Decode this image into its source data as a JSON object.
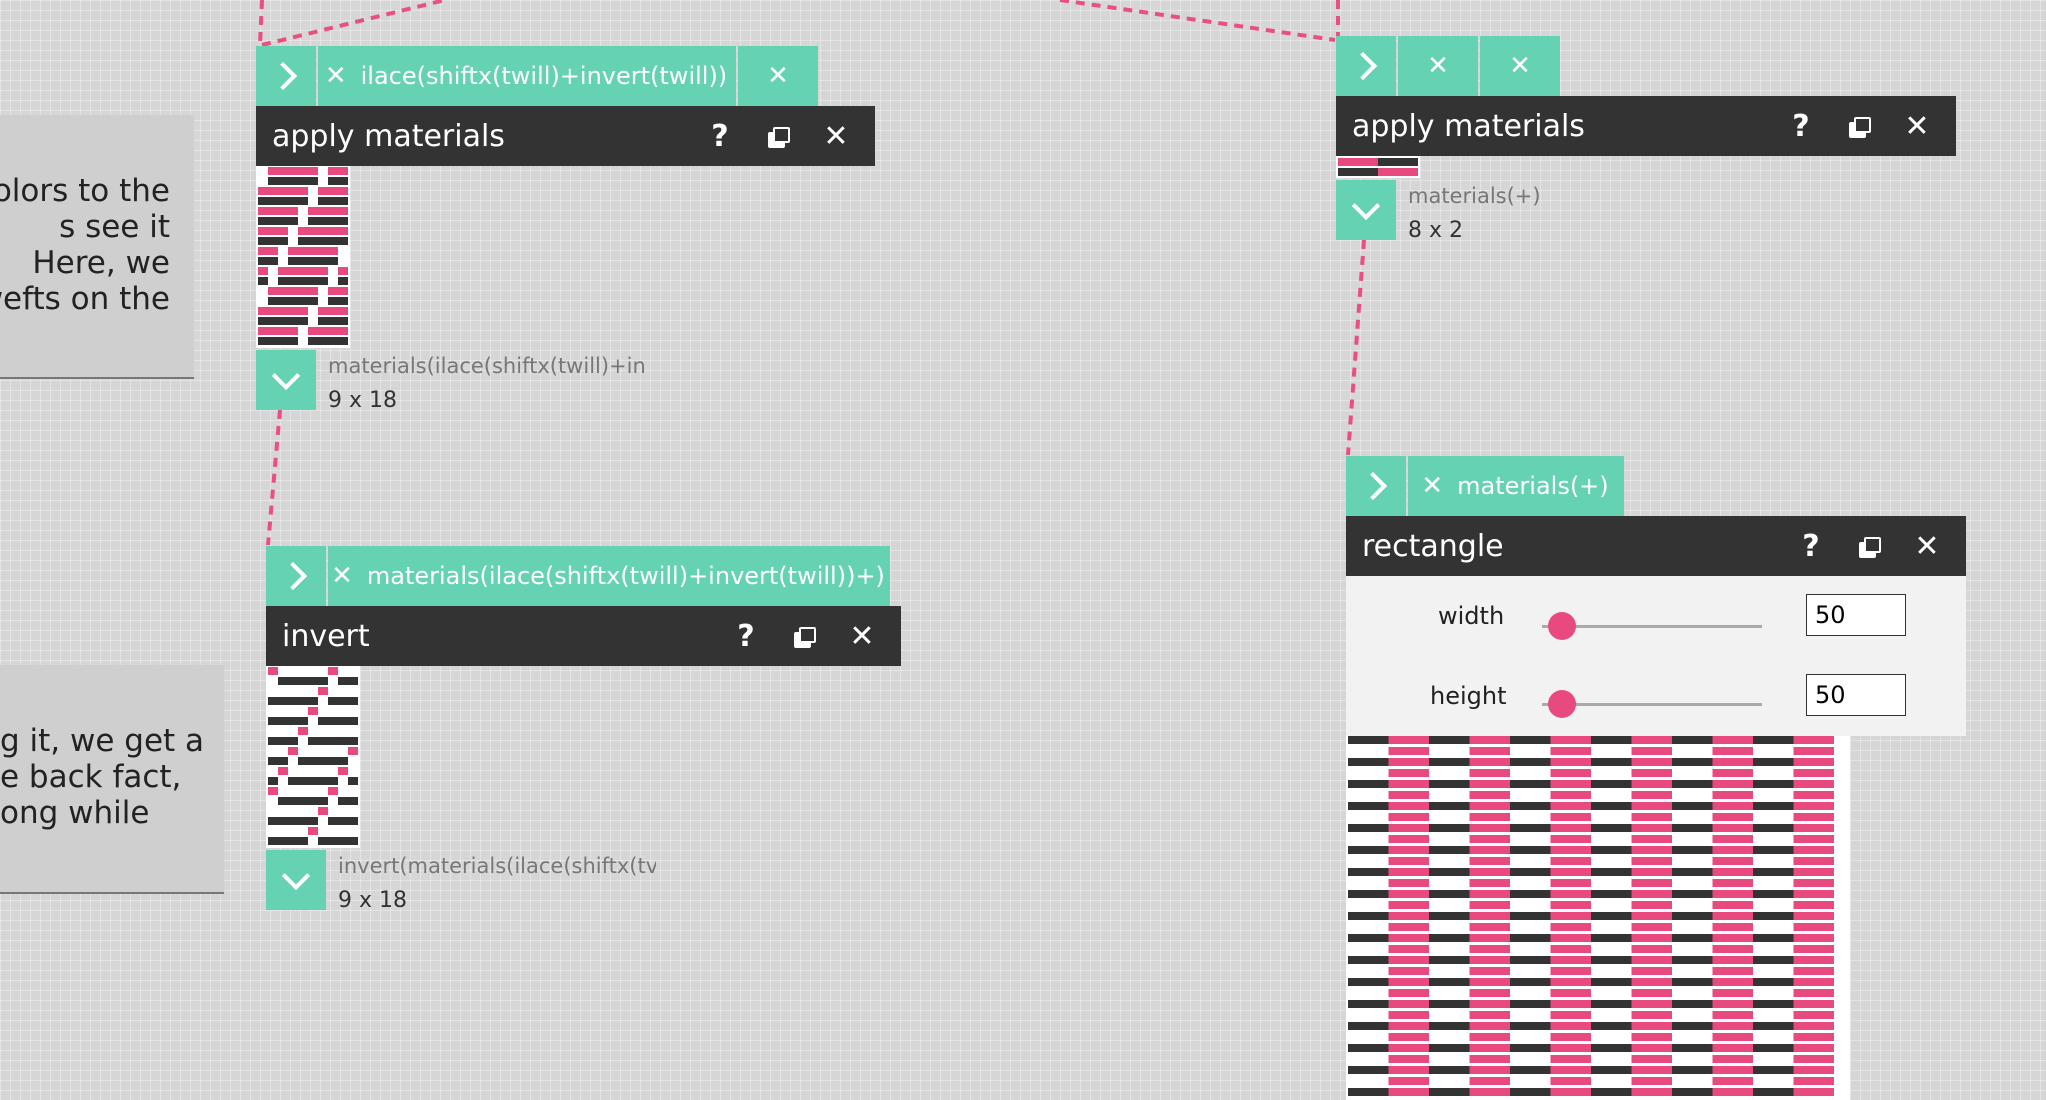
{
  "colors": {
    "accent": "#66d2b4",
    "pink": "#e84a7f",
    "dark": "#333333",
    "white": "#ffffff",
    "connector": "#e8507f"
  },
  "notes": [
    {
      "lines": [
        "olors to the",
        "s see it",
        "Here, we",
        "wefts on the"
      ]
    },
    {
      "lines": [
        "g it, we get a",
        "e back fact,",
        "ong while"
      ]
    }
  ],
  "nodes": {
    "apply_left": {
      "title": "apply materials",
      "tab_label": "ilace(shiftx(twill)+invert(twill))",
      "expr": "materials(ilace(shiftx(twill)+in",
      "dims": "9 x 18"
    },
    "invert": {
      "title": "invert",
      "tab_label": "materials(ilace(shiftx(twill)+invert(twill))+)",
      "expr": "invert(materials(ilace(shiftx(tv",
      "dims": "9 x 18"
    },
    "apply_right": {
      "title": "apply materials",
      "expr": "materials(+)",
      "dims": "8 x 2"
    },
    "rectangle": {
      "title": "rectangle",
      "tab_label": "materials(+)",
      "params": [
        {
          "label": "width",
          "value": "50"
        },
        {
          "label": "height",
          "value": "50"
        }
      ]
    }
  },
  "controls": {
    "help": "?",
    "close": "✕",
    "remove": "✕"
  }
}
